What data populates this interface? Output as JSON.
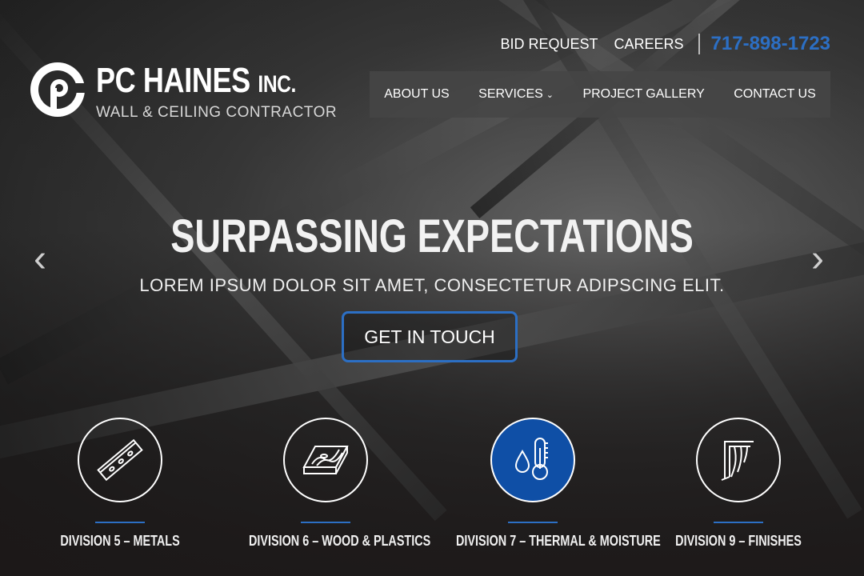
{
  "header": {
    "logo_name": "PC HAINES",
    "logo_suffix": "INC.",
    "logo_tagline": "WALL & CEILING CONTRACTOR",
    "top_links": [
      "BID REQUEST",
      "CAREERS"
    ],
    "phone": "717-898-1723"
  },
  "nav": {
    "items": [
      "ABOUT US",
      "SERVICES",
      "PROJECT GALLERY",
      "CONTACT US"
    ]
  },
  "hero": {
    "headline": "SURPASSING EXPECTATIONS",
    "subline": "LOREM IPSUM DOLOR SIT AMET, CONSECTETUR ADIPSCING ELIT.",
    "cta_label": "GET IN TOUCH",
    "prev_arrow": "‹",
    "next_arrow": "›"
  },
  "divisions": [
    {
      "label": "DIVISION 5 – METALS",
      "icon": "metal-stud-icon"
    },
    {
      "label": "DIVISION 6 – WOOD & PLASTICS",
      "icon": "wood-board-icon"
    },
    {
      "label": "DIVISION 7 – THERMAL & MOISTURE",
      "icon": "thermometer-drop-icon"
    },
    {
      "label": "DIVISION 9 – FINISHES",
      "icon": "drywall-finish-icon"
    }
  ],
  "colors": {
    "accent_blue": "#2c6fc4",
    "active_circle": "#0f4fa6",
    "nav_background": "#464646"
  }
}
